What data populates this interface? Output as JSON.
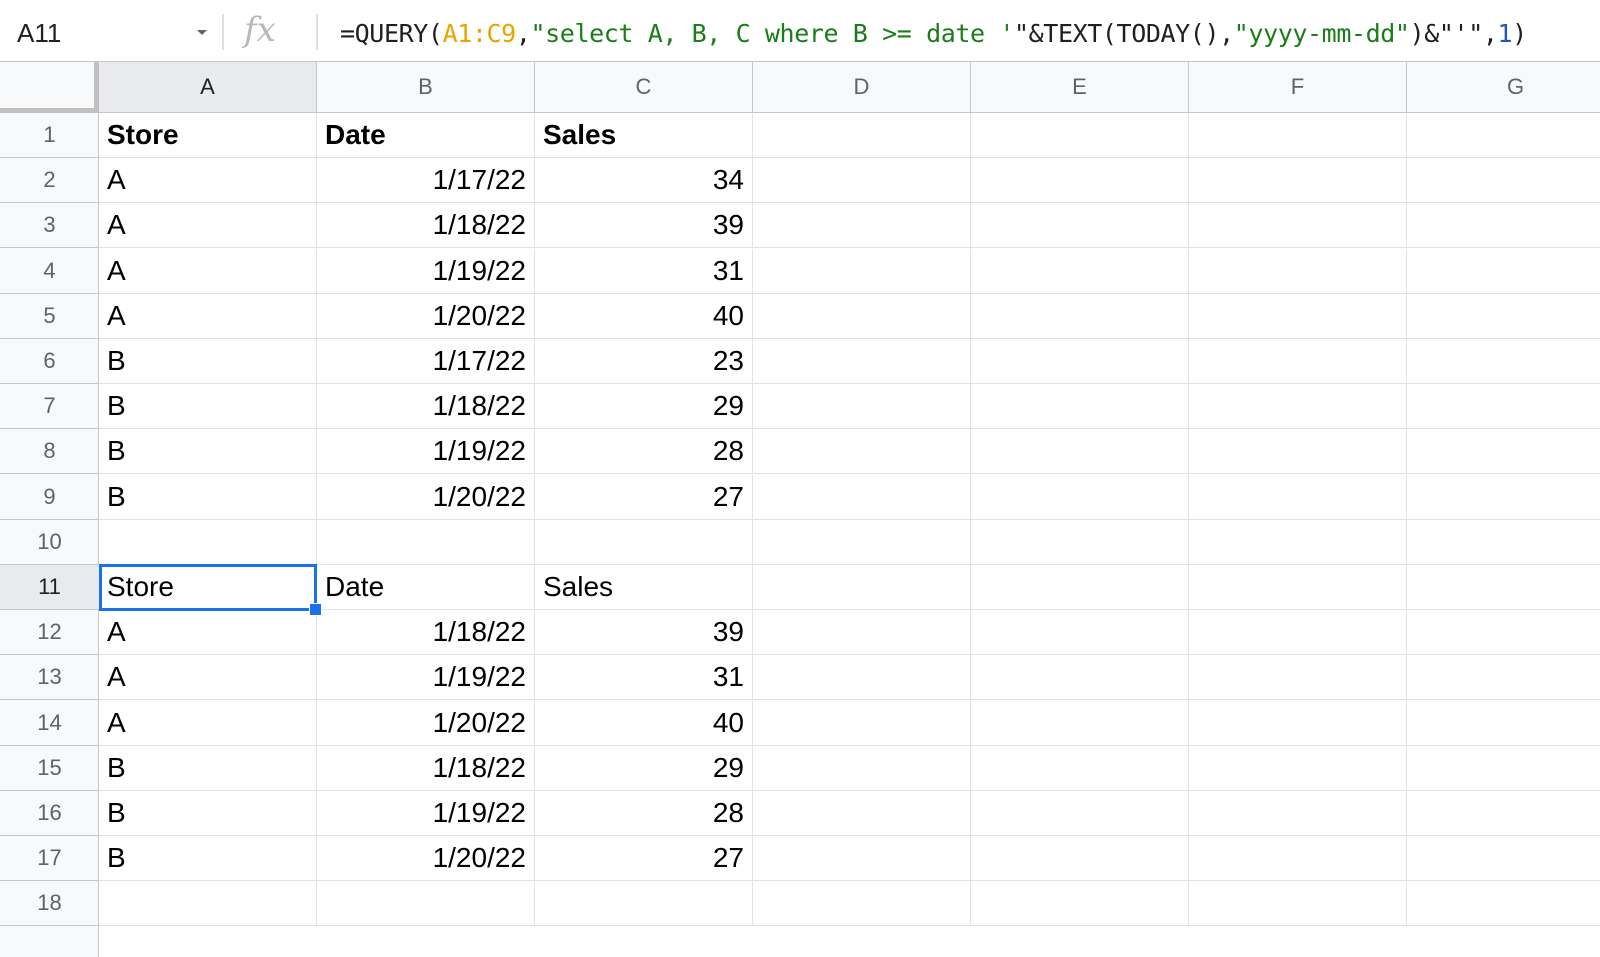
{
  "name_box": {
    "value": "A11"
  },
  "formula_bar": {
    "fx_label": "fx",
    "tokens": [
      {
        "text": "=QUERY(",
        "kind": "plain"
      },
      {
        "text": "A1:C9",
        "kind": "range"
      },
      {
        "text": ",",
        "kind": "plain"
      },
      {
        "text": "\"select A, B, C where B >= date '",
        "kind": "str"
      },
      {
        "text": "\"&TEXT(TODAY(),",
        "kind": "plain"
      },
      {
        "text": "\"yyyy-mm-dd\"",
        "kind": "str"
      },
      {
        "text": ")&\"'\",",
        "kind": "plain"
      },
      {
        "text": "1",
        "kind": "num"
      },
      {
        "text": ")",
        "kind": "plain"
      }
    ]
  },
  "columns": [
    "A",
    "B",
    "C",
    "D",
    "E",
    "F",
    "G"
  ],
  "selected_column": "A",
  "selected_row": 11,
  "rows": [
    {
      "n": "1",
      "cells": [
        {
          "v": "Store",
          "b": true
        },
        {
          "v": "Date",
          "b": true
        },
        {
          "v": "Sales",
          "b": true
        }
      ]
    },
    {
      "n": "2",
      "cells": [
        {
          "v": "A"
        },
        {
          "v": "1/17/22",
          "r": true
        },
        {
          "v": "34",
          "r": true
        }
      ]
    },
    {
      "n": "3",
      "cells": [
        {
          "v": "A"
        },
        {
          "v": "1/18/22",
          "r": true
        },
        {
          "v": "39",
          "r": true
        }
      ]
    },
    {
      "n": "4",
      "cells": [
        {
          "v": "A"
        },
        {
          "v": "1/19/22",
          "r": true
        },
        {
          "v": "31",
          "r": true
        }
      ]
    },
    {
      "n": "5",
      "cells": [
        {
          "v": "A"
        },
        {
          "v": "1/20/22",
          "r": true
        },
        {
          "v": "40",
          "r": true
        }
      ]
    },
    {
      "n": "6",
      "cells": [
        {
          "v": "B"
        },
        {
          "v": "1/17/22",
          "r": true
        },
        {
          "v": "23",
          "r": true
        }
      ]
    },
    {
      "n": "7",
      "cells": [
        {
          "v": "B"
        },
        {
          "v": "1/18/22",
          "r": true
        },
        {
          "v": "29",
          "r": true
        }
      ]
    },
    {
      "n": "8",
      "cells": [
        {
          "v": "B"
        },
        {
          "v": "1/19/22",
          "r": true
        },
        {
          "v": "28",
          "r": true
        }
      ]
    },
    {
      "n": "9",
      "cells": [
        {
          "v": "B"
        },
        {
          "v": "1/20/22",
          "r": true
        },
        {
          "v": "27",
          "r": true
        }
      ]
    },
    {
      "n": "10",
      "cells": []
    },
    {
      "n": "11",
      "cells": [
        {
          "v": "Store"
        },
        {
          "v": "Date"
        },
        {
          "v": "Sales"
        }
      ]
    },
    {
      "n": "12",
      "cells": [
        {
          "v": "A"
        },
        {
          "v": "1/18/22",
          "r": true
        },
        {
          "v": "39",
          "r": true
        }
      ]
    },
    {
      "n": "13",
      "cells": [
        {
          "v": "A"
        },
        {
          "v": "1/19/22",
          "r": true
        },
        {
          "v": "31",
          "r": true
        }
      ]
    },
    {
      "n": "14",
      "cells": [
        {
          "v": "A"
        },
        {
          "v": "1/20/22",
          "r": true
        },
        {
          "v": "40",
          "r": true
        }
      ]
    },
    {
      "n": "15",
      "cells": [
        {
          "v": "B"
        },
        {
          "v": "1/18/22",
          "r": true
        },
        {
          "v": "29",
          "r": true
        }
      ]
    },
    {
      "n": "16",
      "cells": [
        {
          "v": "B"
        },
        {
          "v": "1/19/22",
          "r": true
        },
        {
          "v": "28",
          "r": true
        }
      ]
    },
    {
      "n": "17",
      "cells": [
        {
          "v": "B"
        },
        {
          "v": "1/20/22",
          "r": true
        },
        {
          "v": "27",
          "r": true
        }
      ]
    },
    {
      "n": "18",
      "cells": []
    }
  ],
  "colors": {
    "selection": "#1a73e8",
    "header_bg": "#f8f9fa",
    "header_selected_bg": "#e8eaed",
    "formula_range": "#e8a400",
    "formula_string": "#1a7d1a",
    "formula_number": "#1a56c4"
  }
}
